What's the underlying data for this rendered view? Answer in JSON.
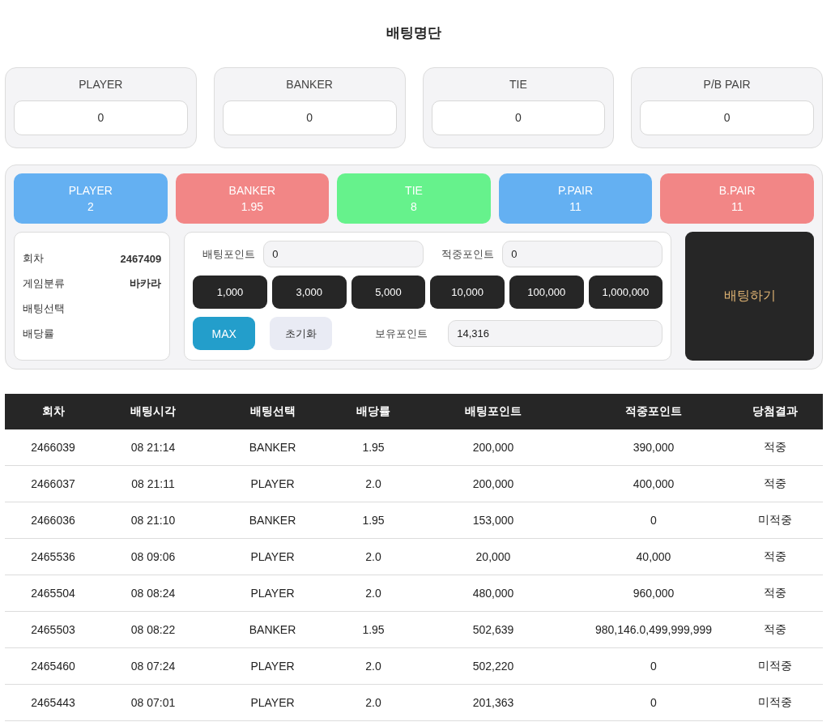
{
  "title": "배팅명단",
  "summary_cards": [
    {
      "label": "PLAYER",
      "value": "0"
    },
    {
      "label": "BANKER",
      "value": "0"
    },
    {
      "label": "TIE",
      "value": "0"
    },
    {
      "label": "P/B PAIR",
      "value": "0"
    }
  ],
  "bet_options": [
    {
      "label": "PLAYER",
      "odds": "2",
      "color": "#64b0f2"
    },
    {
      "label": "BANKER",
      "odds": "1.95",
      "color": "#f28686"
    },
    {
      "label": "TIE",
      "odds": "8",
      "color": "#66f28c"
    },
    {
      "label": "P.PAIR",
      "odds": "11",
      "color": "#64b0f2"
    },
    {
      "label": "B.PAIR",
      "odds": "11",
      "color": "#f28686"
    }
  ],
  "info": [
    {
      "label": "회차",
      "value": "2467409"
    },
    {
      "label": "게임분류",
      "value": "바카라"
    },
    {
      "label": "배팅선택"
    },
    {
      "label": "배당률"
    }
  ],
  "bet_point": {
    "label": "배팅포인트",
    "value": "0"
  },
  "win_point": {
    "label": "적중포인트",
    "value": "0"
  },
  "chips": [
    "1,000",
    "3,000",
    "5,000",
    "10,000",
    "100,000",
    "1,000,000"
  ],
  "max_button": "MAX",
  "reset_button": "초기화",
  "held_point": {
    "label": "보유포인트",
    "value": "14,316"
  },
  "bet_button": "배팅하기",
  "table": {
    "columns": [
      "회차",
      "배팅시각",
      "배팅선택",
      "배당률",
      "배팅포인트",
      "적중포인트",
      "당첨결과"
    ],
    "rows": [
      [
        "2466039",
        "08 21:14",
        "BANKER",
        "1.95",
        "200,000",
        "390,000",
        "적중"
      ],
      [
        "2466037",
        "08 21:11",
        "PLAYER",
        "2.0",
        "200,000",
        "400,000",
        "적중"
      ],
      [
        "2466036",
        "08 21:10",
        "BANKER",
        "1.95",
        "153,000",
        "0",
        "미적중"
      ],
      [
        "2465536",
        "08 09:06",
        "PLAYER",
        "2.0",
        "20,000",
        "40,000",
        "적중"
      ],
      [
        "2465504",
        "08 08:24",
        "PLAYER",
        "2.0",
        "480,000",
        "960,000",
        "적중"
      ],
      [
        "2465503",
        "08 08:22",
        "BANKER",
        "1.95",
        "502,639",
        "980,146.0,499,999,999",
        "적중"
      ],
      [
        "2465460",
        "08 07:24",
        "PLAYER",
        "2.0",
        "502,220",
        "0",
        "미적중"
      ],
      [
        "2465443",
        "08 07:01",
        "PLAYER",
        "2.0",
        "201,363",
        "0",
        "미적중"
      ]
    ]
  }
}
